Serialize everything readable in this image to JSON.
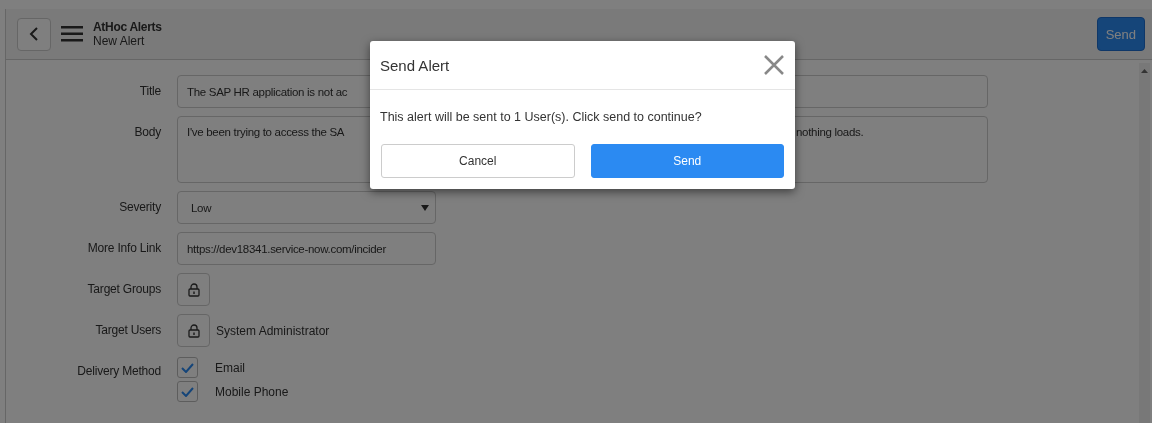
{
  "header": {
    "title": "AtHoc Alerts",
    "subtitle": "New Alert",
    "send_button": "Send"
  },
  "form": {
    "fields": [
      {
        "kind": "text",
        "label": "Title",
        "value": "The SAP HR application is not ac"
      },
      {
        "kind": "textarea",
        "label": "Body",
        "value_parts": [
          "I've been trying to access the SA",
          "nothing loads."
        ]
      },
      {
        "kind": "select",
        "label": "Severity",
        "value": "Low"
      },
      {
        "kind": "text",
        "label": "More Info Link",
        "value": "https://dev18341.service-now.com/incider"
      },
      {
        "kind": "picker",
        "label": "Target Groups"
      },
      {
        "kind": "picker",
        "label": "Target Users",
        "value": "System Administrator"
      },
      {
        "kind": "checks",
        "label": "Delivery Method",
        "options": [
          {
            "label": "Email",
            "checked": true
          },
          {
            "label": "Mobile Phone",
            "checked": true
          }
        ]
      }
    ]
  },
  "dialog": {
    "title": "Send Alert",
    "message": "This alert will be sent to 1 User(s). Click send to continue?",
    "buttons": [
      {
        "label": "Cancel",
        "kind": "secondary"
      },
      {
        "label": "Send",
        "kind": "primary"
      }
    ]
  }
}
